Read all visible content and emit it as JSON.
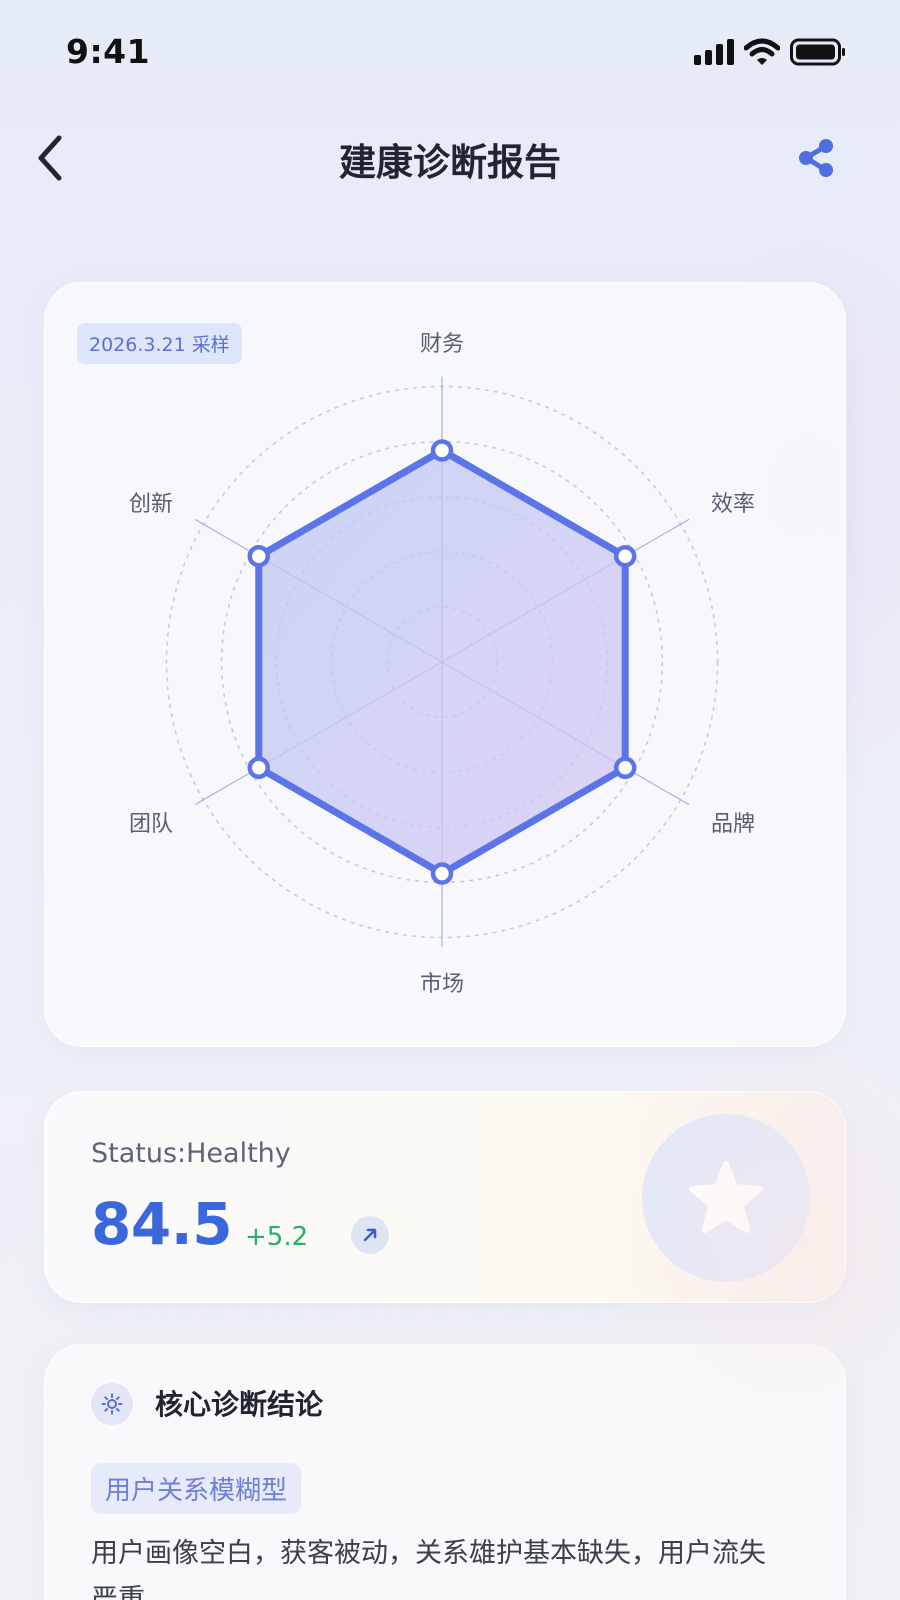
{
  "status_bar": {
    "time": "9:41"
  },
  "nav": {
    "title": "建康诊断报告",
    "back_icon": "chevron-left-icon",
    "share_icon": "share-icon"
  },
  "radar": {
    "date_badge": "2026.3.21 采样",
    "colors": {
      "line": "#5b74e8",
      "fill": "#b9c3f3"
    }
  },
  "chart_data": {
    "type": "radar",
    "axes": [
      "财务",
      "效率",
      "品牌",
      "市场",
      "团队",
      "创新"
    ],
    "values": [
      86,
      86,
      86,
      86,
      86,
      86
    ],
    "range": [
      0,
      100
    ],
    "grid": true
  },
  "score": {
    "status_label": "Status:Healthy",
    "value": "84.5",
    "delta": "+5.2",
    "trend_icon": "arrow-up-right-icon",
    "badge_icon": "star-icon",
    "colors": {
      "value": "#3a68dc",
      "delta": "#28b06a"
    }
  },
  "diagnosis": {
    "icon": "sun-icon",
    "title": "核心诊断结论",
    "tag": "用户关系模糊型",
    "text": "用户画像空白，获客被动，关系雄护基本缺失，用户流失严重"
  }
}
